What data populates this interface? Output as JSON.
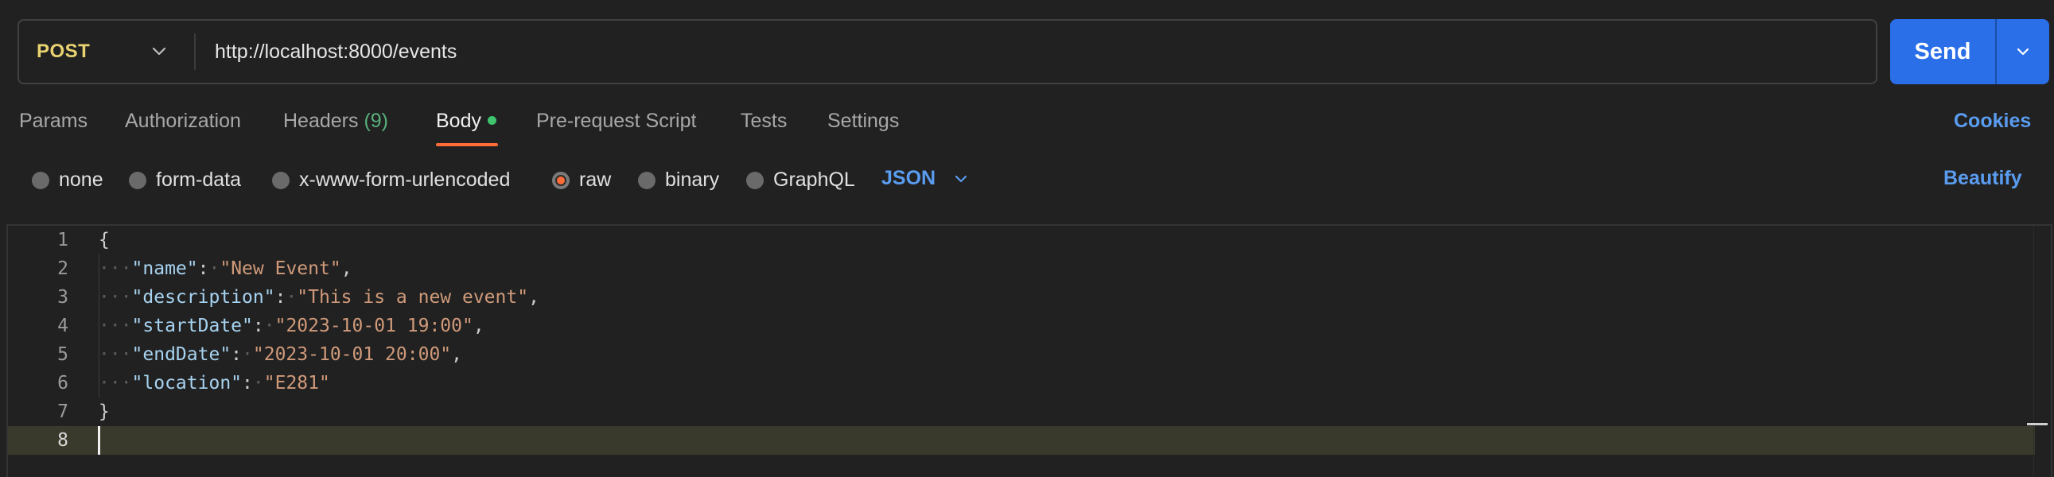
{
  "request": {
    "method": "POST",
    "url": "http://localhost:8000/events",
    "send_label": "Send"
  },
  "tabs": {
    "params": "Params",
    "authorization": "Authorization",
    "headers": "Headers",
    "headers_count": "(9)",
    "body": "Body",
    "pre_request": "Pre-request Script",
    "tests": "Tests",
    "settings": "Settings",
    "active": "Body"
  },
  "cookies_label": "Cookies",
  "body_types": {
    "none": "none",
    "form_data": "form-data",
    "urlencoded": "x-www-form-urlencoded",
    "raw": "raw",
    "binary": "binary",
    "graphql": "GraphQL",
    "selected": "raw"
  },
  "format": {
    "selected": "JSON"
  },
  "beautify_label": "Beautify",
  "editor": {
    "lines": [
      {
        "n": "1",
        "text": "{"
      },
      {
        "n": "2",
        "key": "\"name\"",
        "value": "\"New Event\"",
        "trail": ","
      },
      {
        "n": "3",
        "key": "\"description\"",
        "value": "\"This is a new event\"",
        "trail": ","
      },
      {
        "n": "4",
        "key": "\"startDate\"",
        "value": "\"2023-10-01 19:00\"",
        "trail": ","
      },
      {
        "n": "5",
        "key": "\"endDate\"",
        "value": "\"2023-10-01 20:00\"",
        "trail": ","
      },
      {
        "n": "6",
        "key": "\"location\"",
        "value": "\"E281\"",
        "trail": ""
      },
      {
        "n": "7",
        "text": "}"
      },
      {
        "n": "8",
        "text": ""
      }
    ],
    "current_line": "8"
  },
  "colors": {
    "accent": "#ff6c37",
    "send_button": "#2a6ee8",
    "link": "#5a9cf0",
    "method_post": "#e9d370",
    "body_dot": "#3ec46d"
  },
  "icons": {
    "method_dropdown": "chevron-down-icon",
    "send_dropdown": "chevron-down-icon",
    "format_dropdown": "chevron-down-icon"
  }
}
